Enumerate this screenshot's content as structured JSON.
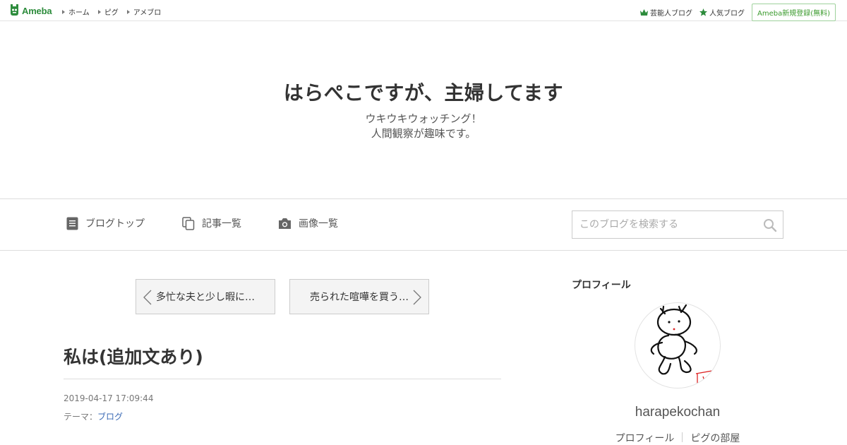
{
  "topbar": {
    "logo_text": "Ameba",
    "nav": [
      {
        "label": "ホーム"
      },
      {
        "label": "ピグ"
      },
      {
        "label": "アメブロ"
      }
    ],
    "celebrity_blog": "芸能人ブログ",
    "popular_blog": "人気ブログ",
    "signup": "Ameba新規登録(無料)"
  },
  "header": {
    "title": "はらぺこですが、主婦してます",
    "description_line1": "ウキウキウォッチング！",
    "description_line2": "人間観察が趣味です。"
  },
  "nav": {
    "blog_top": "ブログトップ",
    "entry_list": "記事一覧",
    "image_list": "画像一覧",
    "search_placeholder": "このブログを検索する"
  },
  "pager": {
    "prev": "多忙な夫と少し暇に…",
    "next": "売られた喧嘩を買う…"
  },
  "article": {
    "title": "私は(追加文あり)",
    "date": "2019-04-17 17:09:44",
    "theme_label": "テーマ：",
    "theme_value": "ブログ"
  },
  "sidebar": {
    "heading": "プロフィール",
    "username": "harapekochan",
    "profile_link": "プロフィール",
    "room_link": "ピグの部屋"
  },
  "colors": {
    "brand_green": "#2d8c3c",
    "link_blue": "#3a6ab5"
  }
}
